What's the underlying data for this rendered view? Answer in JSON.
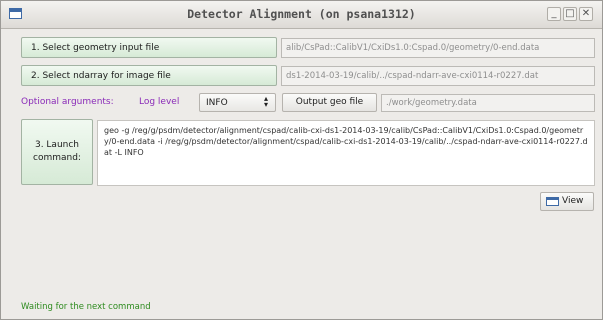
{
  "window": {
    "title": "Detector Alignment (on psana1312)",
    "controls": {
      "minimize": "_",
      "maximize": "□",
      "close": "✕"
    }
  },
  "geometry_input": {
    "button_label": "1. Select geometry input file",
    "path": "alib/CsPad::CalibV1/CxiDs1.0:Cspad.0/geometry/0-end.data"
  },
  "ndarray_input": {
    "button_label": "2. Select ndarray for image file",
    "path": "ds1-2014-03-19/calib/../cspad-ndarr-ave-cxi0114-r0227.dat"
  },
  "optional": {
    "label": "Optional arguments:",
    "log_level_label": "Log level",
    "log_level_value": "INFO",
    "output_button_label": "Output geo file",
    "output_path": "./work/geometry.data"
  },
  "launch": {
    "button_line1": "3. Launch",
    "button_line2": "command:",
    "command_text": "geo -g /reg/g/psdm/detector/alignment/cspad/calib-cxi-ds1-2014-03-19/calib/CsPad::CalibV1/CxiDs1.0:Cspad.0/geometry/0-end.data -i /reg/g/psdm/detector/alignment/cspad/calib-cxi-ds1-2014-03-19/calib/../cspad-ndarr-ave-cxi0114-r0227.dat -L INFO"
  },
  "view_button": {
    "label": "View"
  },
  "status": {
    "text": "Waiting for the next command"
  },
  "colors": {
    "green_button": "#d6ead6",
    "optional_label": "#8a2bb8",
    "status_text": "#2e8b1f"
  }
}
